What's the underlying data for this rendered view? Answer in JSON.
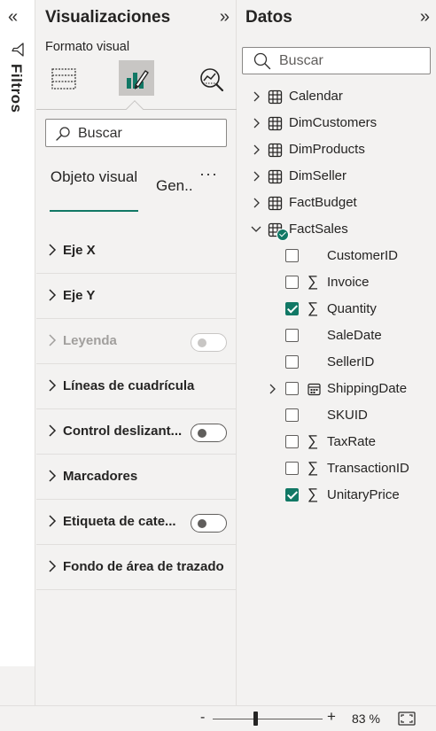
{
  "filters": {
    "label": "Filtros"
  },
  "visualizations": {
    "title": "Visualizaciones",
    "subtitle": "Formato visual",
    "search_placeholder": "Buscar",
    "tabs": [
      {
        "label": "Objeto visual",
        "active": true
      },
      {
        "label": "Gen.."
      }
    ],
    "sections": [
      {
        "label": "Eje X"
      },
      {
        "label": "Eje Y"
      },
      {
        "label": "Leyenda",
        "disabled": true,
        "toggle": "off"
      },
      {
        "label": "Líneas de cuadrícula"
      },
      {
        "label": "Control deslizant...",
        "toggle": "off"
      },
      {
        "label": "Marcadores"
      },
      {
        "label": "Etiqueta de cate...",
        "toggle": "off"
      },
      {
        "label": "Fondo de área de trazado"
      }
    ]
  },
  "data_pane": {
    "title": "Datos",
    "search_placeholder": "Buscar",
    "tables": [
      {
        "name": "Calendar"
      },
      {
        "name": "DimCustomers"
      },
      {
        "name": "DimProducts"
      },
      {
        "name": "DimSeller"
      },
      {
        "name": "FactBudget"
      },
      {
        "name": "FactSales",
        "expanded": true,
        "has_selection": true
      }
    ],
    "fields": [
      {
        "name": "CustomerID",
        "checked": false,
        "icon": "none"
      },
      {
        "name": "Invoice",
        "checked": false,
        "icon": "sigma"
      },
      {
        "name": "Quantity",
        "checked": true,
        "icon": "sigma"
      },
      {
        "name": "SaleDate",
        "checked": false,
        "icon": "none"
      },
      {
        "name": "SellerID",
        "checked": false,
        "icon": "none"
      },
      {
        "name": "ShippingDate",
        "checked": false,
        "icon": "calendar",
        "expandable": true
      },
      {
        "name": "SKUID",
        "checked": false,
        "icon": "none"
      },
      {
        "name": "TaxRate",
        "checked": false,
        "icon": "sigma"
      },
      {
        "name": "TransactionID",
        "checked": false,
        "icon": "sigma"
      },
      {
        "name": "UnitaryPrice",
        "checked": true,
        "icon": "sigma"
      }
    ]
  },
  "statusbar": {
    "zoom_minus": "-",
    "zoom_plus": "+",
    "zoom_percent": "83 %",
    "zoom_level": 0.83
  },
  "symbols": {
    "collapse": "«",
    "expand": "»",
    "sigma": "∑",
    "more": "···"
  },
  "colors": {
    "accent": "#117865",
    "pane_bg": "#f3f2f1",
    "active_icon_bg": "#c8c6c4"
  }
}
